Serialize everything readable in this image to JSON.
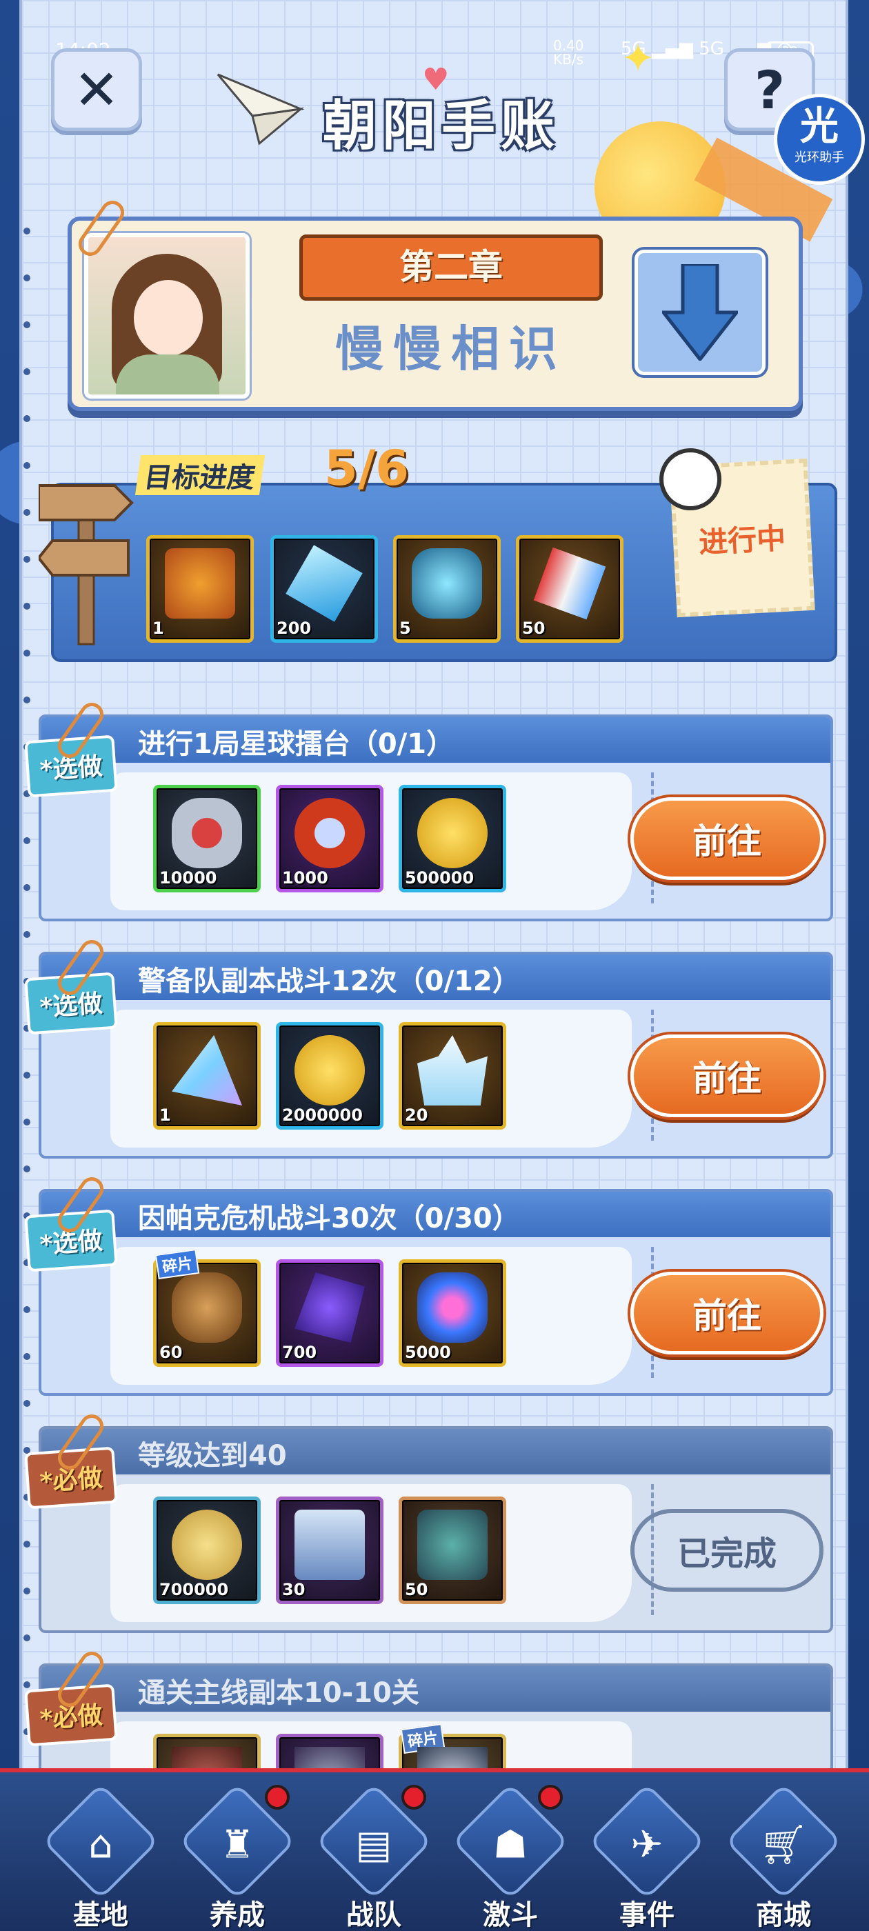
{
  "status_bar": {
    "time": "14:02",
    "net_speed": "0.40\nKB/s",
    "battery": "28"
  },
  "header": {
    "title": "朝阳手账",
    "helper_big": "光",
    "helper_small": "光环助手"
  },
  "chapter": {
    "label": "第二章",
    "name": "慢慢相识"
  },
  "progress": {
    "label": "目标进度",
    "value": "5/6",
    "status": "进行中",
    "rewards": [
      {
        "icon": "gift-box-icon",
        "qty": "1"
      },
      {
        "icon": "blue-crystal-icon",
        "qty": "200"
      },
      {
        "icon": "energy-container-icon",
        "qty": "5"
      },
      {
        "icon": "red-white-crystal-icon",
        "qty": "50"
      }
    ]
  },
  "tasks": [
    {
      "tag": "*选做",
      "title": "进行1局星球擂台（0/1）",
      "button": "前往",
      "rewards": [
        {
          "icon": "winged-badge-icon",
          "qty": "10000",
          "frame": "green"
        },
        {
          "icon": "emblem-icon",
          "qty": "1000",
          "frame": "purple"
        },
        {
          "icon": "gold-coin-icon",
          "qty": "500000",
          "frame": "blue"
        }
      ]
    },
    {
      "tag": "*选做",
      "title": "警备队副本战斗12次（0/12）",
      "button": "前往",
      "rewards": [
        {
          "icon": "prism-icon",
          "qty": "1",
          "frame": "gold"
        },
        {
          "icon": "gold-coin-icon",
          "qty": "2000000",
          "frame": "blue"
        },
        {
          "icon": "crystal-cluster-icon",
          "qty": "20",
          "frame": "gold"
        }
      ]
    },
    {
      "tag": "*选做",
      "title": "因帕克危机战斗30次（0/30）",
      "button": "前往",
      "rewards": [
        {
          "icon": "monster-fragment-icon",
          "qty": "60",
          "frame": "gold",
          "fragment": "碎片"
        },
        {
          "icon": "purple-ore-icon",
          "qty": "700",
          "frame": "purple"
        },
        {
          "icon": "blue-core-icon",
          "qty": "5000",
          "frame": "gold"
        }
      ]
    },
    {
      "tag": "*必做",
      "title": "等级达到40",
      "button": "已完成",
      "rewards": [
        {
          "icon": "gold-coin-icon",
          "qty": "700000",
          "frame": "blue"
        },
        {
          "icon": "supply-crate-icon",
          "qty": "30",
          "frame": "purple"
        },
        {
          "icon": "egg-card-icon",
          "qty": "50",
          "frame": "orange"
        }
      ]
    },
    {
      "tag": "*必做",
      "title": "通关主线副本10-10关",
      "rewards": [
        {
          "icon": "red-item-icon",
          "frame": "gold"
        },
        {
          "icon": "mech-part-icon",
          "frame": "purple",
          "fragment": "碎片"
        },
        {
          "icon": "misc-item-icon",
          "frame": "gold"
        }
      ]
    }
  ],
  "nav": [
    {
      "label": "基地",
      "icon": "base-icon",
      "badge": false
    },
    {
      "label": "养成",
      "icon": "training-icon",
      "badge": true
    },
    {
      "label": "战队",
      "icon": "team-icon",
      "badge": true
    },
    {
      "label": "激斗",
      "icon": "battle-icon",
      "badge": true
    },
    {
      "label": "事件",
      "icon": "event-icon",
      "badge": false
    },
    {
      "label": "商城",
      "icon": "shop-cart-icon",
      "badge": false
    }
  ]
}
